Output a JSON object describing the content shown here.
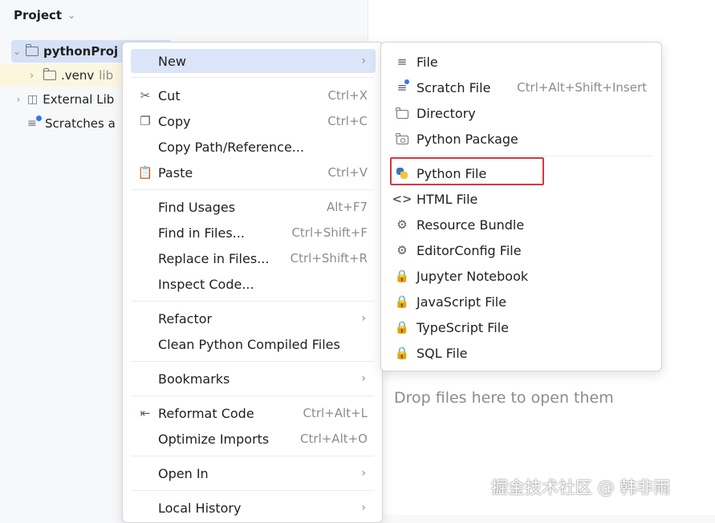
{
  "project_pane": {
    "title": "Project",
    "tree": [
      {
        "name": "pythonProj",
        "extra": ""
      },
      {
        "name": ".venv",
        "extra": "lib"
      },
      {
        "name": "External Lib",
        "extra": ""
      },
      {
        "name": "Scratches a",
        "extra": ""
      }
    ]
  },
  "context_menu": {
    "new": "New",
    "cut": {
      "label": "Cut",
      "shortcut": "Ctrl+X"
    },
    "copy": {
      "label": "Copy",
      "shortcut": "Ctrl+C"
    },
    "copy_path": {
      "label": "Copy Path/Reference..."
    },
    "paste": {
      "label": "Paste",
      "shortcut": "Ctrl+V"
    },
    "find_usages": {
      "label": "Find Usages",
      "shortcut": "Alt+F7"
    },
    "find_in_files": {
      "label": "Find in Files...",
      "shortcut": "Ctrl+Shift+F"
    },
    "replace_in_files": {
      "label": "Replace in Files...",
      "shortcut": "Ctrl+Shift+R"
    },
    "inspect_code": {
      "label": "Inspect Code..."
    },
    "refactor": {
      "label": "Refactor"
    },
    "clean_python": {
      "label": "Clean Python Compiled Files"
    },
    "bookmarks": {
      "label": "Bookmarks"
    },
    "reformat": {
      "label": "Reformat Code",
      "shortcut": "Ctrl+Alt+L"
    },
    "optimize_imports": {
      "label": "Optimize Imports",
      "shortcut": "Ctrl+Alt+O"
    },
    "open_in": {
      "label": "Open In"
    },
    "local_history": {
      "label": "Local History"
    }
  },
  "submenu_new": {
    "file": "File",
    "scratch_file": {
      "label": "Scratch File",
      "shortcut": "Ctrl+Alt+Shift+Insert"
    },
    "directory": "Directory",
    "python_package": "Python Package",
    "python_file": "Python File",
    "html_file": "HTML File",
    "resource_bundle": "Resource Bundle",
    "editorconfig_file": "EditorConfig File",
    "jupyter_notebook": "Jupyter Notebook",
    "javascript_file": "JavaScript File",
    "typescript_file": "TypeScript File",
    "sql_file": "SQL File"
  },
  "editor": {
    "drop_hint": "Drop files here to open them"
  },
  "watermark": "掘金技术社区 @ 韩非雨",
  "colors": {
    "highlight_box": "#d9363e",
    "selection": "#dbe5f9",
    "python_blue": "#3a76b4",
    "python_yellow": "#f2c53d"
  }
}
